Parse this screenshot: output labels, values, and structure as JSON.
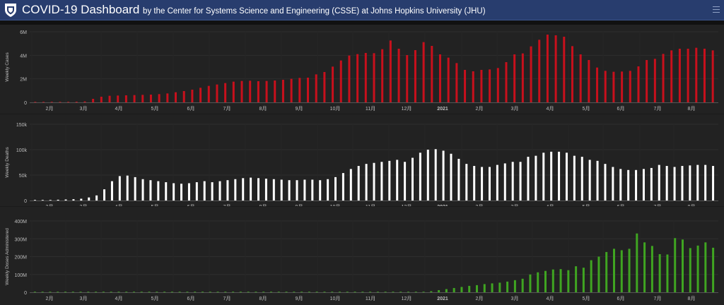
{
  "header": {
    "title": "COVID-19 Dashboard",
    "subtitle": "by the Center for Systems Science and Engineering (CSSE) at Johns Hopkins University (JHU)",
    "menu_icon": "hamburger-menu-icon",
    "logo_icon": "jhu-shield-icon"
  },
  "chart_data": [
    {
      "type": "bar",
      "ylabel": "Weekly Cases",
      "color": "#c8101c",
      "ylim": [
        0,
        6000000
      ],
      "yticks": [
        0,
        2000000,
        4000000,
        6000000
      ],
      "ytick_labels": [
        "0",
        "2M",
        "4M",
        "6M"
      ],
      "x_labels": [
        "2月",
        "3月",
        "4月",
        "5月",
        "6月",
        "7月",
        "8月",
        "9月",
        "10月",
        "11月",
        "12月",
        "2021",
        "2月",
        "3月",
        "4月",
        "5月",
        "6月",
        "7月",
        "8月"
      ],
      "values": [
        20000,
        30000,
        20000,
        20000,
        40000,
        60000,
        80000,
        300000,
        480000,
        560000,
        580000,
        600000,
        620000,
        640000,
        660000,
        700000,
        760000,
        860000,
        960000,
        1080000,
        1240000,
        1400000,
        1520000,
        1640000,
        1760000,
        1820000,
        1840000,
        1800000,
        1820000,
        1860000,
        1920000,
        2000000,
        2080000,
        2100000,
        2380000,
        2580000,
        3040000,
        3560000,
        3980000,
        4100000,
        4200000,
        4180000,
        4520000,
        5260000,
        4560000,
        4020000,
        4440000,
        5120000,
        4800000,
        4080000,
        3800000,
        3340000,
        2760000,
        2640000,
        2760000,
        2800000,
        2920000,
        3420000,
        4080000,
        4160000,
        4760000,
        5320000,
        5760000,
        5700000,
        5580000,
        4780000,
        4080000,
        3600000,
        2960000,
        2680000,
        2600000,
        2620000,
        2680000,
        3060000,
        3600000,
        3700000,
        4120000,
        4420000,
        4560000,
        4560000,
        4640000,
        4560000,
        4420000
      ]
    },
    {
      "type": "bar",
      "ylabel": "Weekly Deaths",
      "color": "#ffffff",
      "ylim": [
        0,
        150000
      ],
      "yticks": [
        0,
        50000,
        100000,
        150000
      ],
      "ytick_labels": [
        "0",
        "50k",
        "100k",
        "150k"
      ],
      "x_labels": [
        "2月",
        "3月",
        "4月",
        "5月",
        "6月",
        "7月",
        "8月",
        "9月",
        "10月",
        "11月",
        "12月",
        "2021",
        "2月",
        "3月",
        "4月",
        "5月",
        "6月",
        "7月",
        "8月"
      ],
      "values": [
        500,
        1000,
        1000,
        1500,
        2000,
        2500,
        3500,
        6000,
        10000,
        22000,
        38000,
        48000,
        49000,
        46000,
        42000,
        40000,
        38000,
        36000,
        34000,
        33000,
        34000,
        36000,
        38000,
        36000,
        38000,
        40000,
        42000,
        44000,
        45000,
        44000,
        43000,
        42000,
        41000,
        40000,
        40000,
        41000,
        41000,
        40000,
        42000,
        46000,
        54000,
        62000,
        68000,
        72000,
        74000,
        76000,
        78000,
        80000,
        76000,
        84000,
        94000,
        100000,
        101000,
        98000,
        92000,
        82000,
        72000,
        68000,
        66000,
        66000,
        70000,
        73000,
        76000,
        76000,
        86000,
        88000,
        94000,
        96000,
        96000,
        94000,
        88000,
        86000,
        80000,
        78000,
        72000,
        66000,
        62000,
        60000,
        60000,
        62000,
        64000,
        70000,
        68000,
        66000,
        68000,
        69000,
        70000,
        70000,
        68000
      ]
    },
    {
      "type": "bar",
      "ylabel": "Weekly Doses Administered",
      "color": "#3fa521",
      "ylim": [
        0,
        400000000
      ],
      "yticks": [
        0,
        100000000,
        200000000,
        300000000,
        400000000
      ],
      "ytick_labels": [
        "0",
        "100M",
        "200M",
        "300M",
        "400M"
      ],
      "x_labels": [
        "2月",
        "3月",
        "4月",
        "5月",
        "6月",
        "7月",
        "8月",
        "9月",
        "10月",
        "11月",
        "12月",
        "2021",
        "2月",
        "3月",
        "4月",
        "5月",
        "6月",
        "7月",
        "8月"
      ],
      "values": [
        200000,
        200000,
        200000,
        200000,
        200000,
        200000,
        200000,
        200000,
        200000,
        200000,
        200000,
        200000,
        200000,
        200000,
        200000,
        200000,
        200000,
        200000,
        200000,
        200000,
        200000,
        200000,
        200000,
        200000,
        200000,
        200000,
        200000,
        200000,
        200000,
        200000,
        200000,
        200000,
        200000,
        200000,
        200000,
        200000,
        200000,
        200000,
        200000,
        200000,
        200000,
        200000,
        200000,
        200000,
        200000,
        200000,
        200000,
        200000,
        200000,
        200000,
        500000,
        2000000,
        6000000,
        12000000,
        18000000,
        24000000,
        30000000,
        36000000,
        40000000,
        46000000,
        50000000,
        54000000,
        60000000,
        68000000,
        76000000,
        100000000,
        112000000,
        120000000,
        128000000,
        130000000,
        124000000,
        146000000,
        138000000,
        180000000,
        200000000,
        226000000,
        244000000,
        236000000,
        244000000,
        330000000,
        280000000,
        260000000,
        214000000,
        212000000,
        304000000,
        296000000,
        248000000,
        262000000,
        280000000,
        250000000
      ]
    }
  ]
}
